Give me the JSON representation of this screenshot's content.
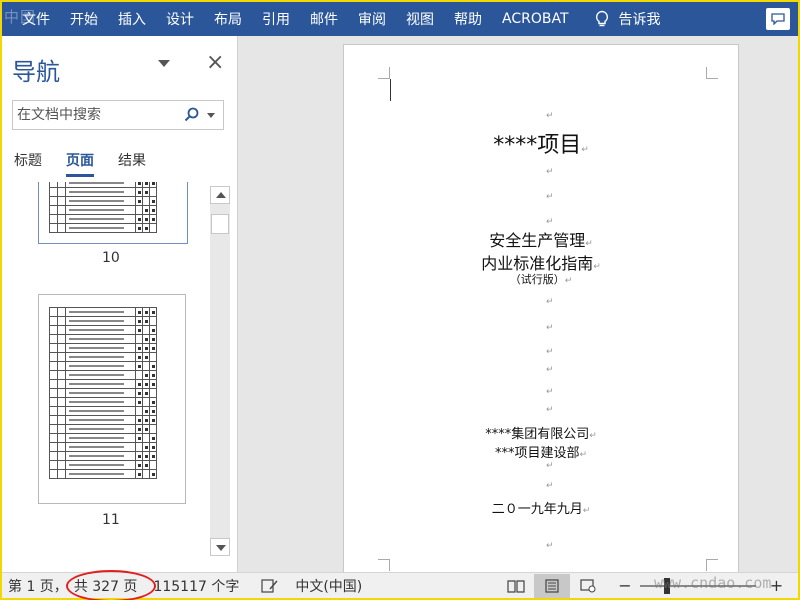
{
  "ribbon": {
    "tabs": [
      "文件",
      "开始",
      "插入",
      "设计",
      "布局",
      "引用",
      "邮件",
      "审阅",
      "视图",
      "帮助",
      "ACROBAT"
    ],
    "tell_me": "告诉我",
    "watermark": "中国"
  },
  "nav": {
    "title": "导航",
    "search_placeholder": "在文档中搜索",
    "tabs": [
      "标题",
      "页面",
      "结果"
    ],
    "active_tab": "页面",
    "pages": [
      "10",
      "11"
    ]
  },
  "document": {
    "title": "****项目",
    "heading1": "安全生产管理",
    "heading2": "内业标准化指南",
    "subtitle": "（试行版）",
    "org1": "****集团有限公司",
    "org2": "***项目建设部",
    "date": "二０一九年九月"
  },
  "status": {
    "page": "第 1 页，",
    "total_pages": "共 327 页",
    "words": "115117 个字",
    "language": "中文(中国)",
    "watermark": "www.cndao.com"
  },
  "colors": {
    "ribbon": "#2b579a",
    "accent": "#2b579a",
    "highlight_circle": "#e02020"
  }
}
